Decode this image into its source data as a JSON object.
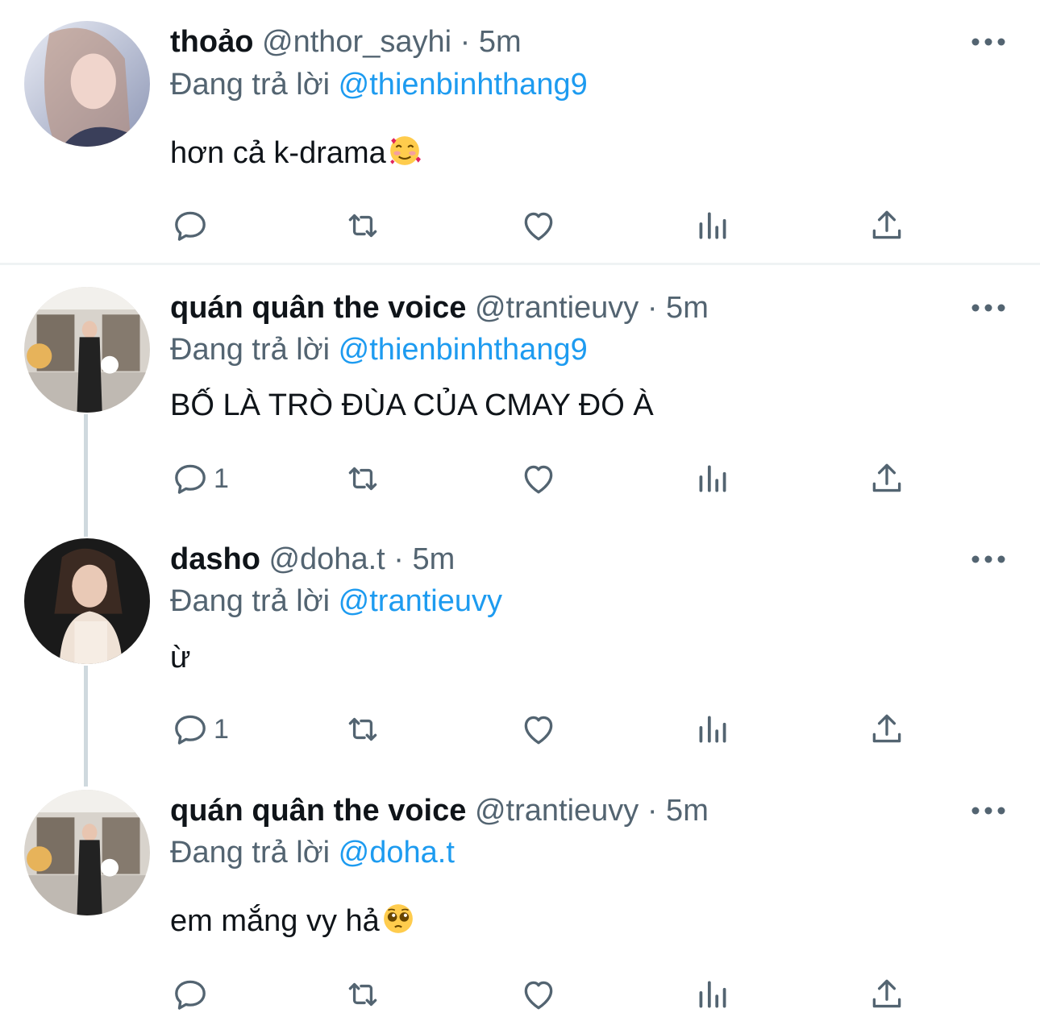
{
  "tweets": [
    {
      "display_name": "thoảo",
      "handle": "@nthor_sayhi",
      "time": "· 5m",
      "reply_prefix": "Đang trả lời",
      "reply_to": "@thienbinhthang9",
      "text": "hơn cả k-drama",
      "emoji": "smiling-face-with-hearts",
      "reply_count": ""
    },
    {
      "display_name": "quán quân the voice",
      "handle": "@trantieuvy",
      "time": "· 5m",
      "reply_prefix": "Đang trả lời",
      "reply_to": "@thienbinhthang9",
      "text": "BỐ LÀ TRÒ ĐÙA CỦA CMAY ĐÓ À",
      "emoji": "",
      "reply_count": "1"
    },
    {
      "display_name": "dasho",
      "handle": "@doha.t",
      "time": "· 5m",
      "reply_prefix": "Đang trả lời",
      "reply_to": "@trantieuvy",
      "text": "ừ",
      "emoji": "",
      "reply_count": "1"
    },
    {
      "display_name": "quán quân the voice",
      "handle": "@trantieuvy",
      "time": "· 5m",
      "reply_prefix": "Đang trả lời",
      "reply_to": "@doha.t",
      "text": "em mắng vy hả",
      "emoji": "pleading-face",
      "reply_count": ""
    }
  ],
  "icons": {
    "reply": "speech-bubble-icon",
    "retweet": "retweet-icon",
    "like": "heart-icon",
    "views": "bar-chart-icon",
    "share": "share-upload-icon",
    "more": "more-dots-icon"
  },
  "colors": {
    "text": "#0f1419",
    "secondary": "#536471",
    "link": "#1d9bf0",
    "divider": "#eff3f4",
    "thread_line": "#cfd9de"
  }
}
